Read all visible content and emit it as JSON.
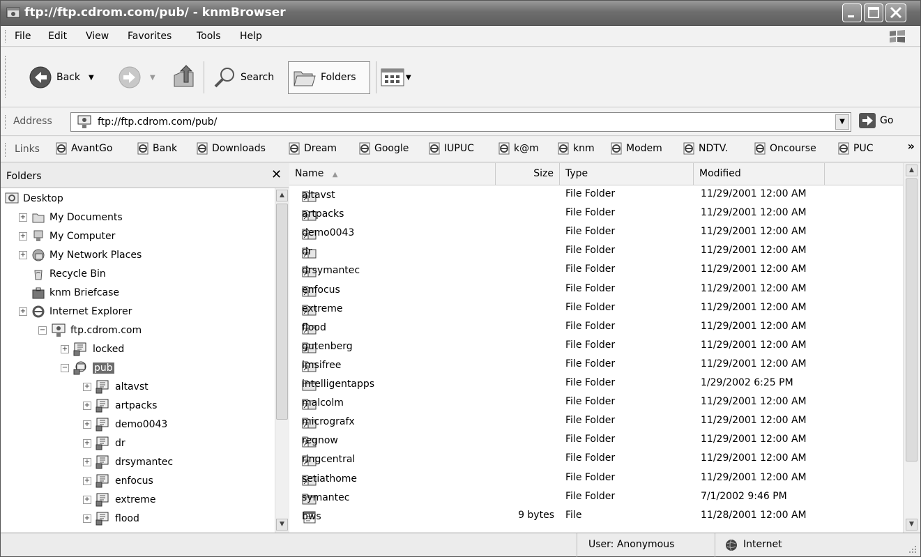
{
  "window": {
    "title": "ftp://ftp.cdrom.com/pub/ - knmBrowser"
  },
  "menu": [
    "File",
    "Edit",
    "View",
    "Favorites",
    "Tools",
    "Help"
  ],
  "toolbar": {
    "back": "Back",
    "search": "Search",
    "folders": "Folders"
  },
  "address": {
    "label": "Address",
    "value": "ftp://ftp.cdrom.com/pub/",
    "go": "Go"
  },
  "links": {
    "label": "Links",
    "items": [
      "AvantGo",
      "Bank",
      "Downloads",
      "Dream",
      "Google",
      "IUPUC",
      "k@m",
      "knm",
      "Modem",
      "NDTV.",
      "Oncourse",
      "PUC"
    ]
  },
  "folders_pane": {
    "title": "Folders",
    "tree": [
      {
        "label": "Desktop",
        "icon": "desktop-icon",
        "pm": "",
        "level": 0
      },
      {
        "label": "My Documents",
        "icon": "documents-folder-icon",
        "pm": "+",
        "level": 1
      },
      {
        "label": "My Computer",
        "icon": "computer-icon",
        "pm": "+",
        "level": 1
      },
      {
        "label": "My Network Places",
        "icon": "network-icon",
        "pm": "+",
        "level": 1
      },
      {
        "label": "Recycle Bin",
        "icon": "recycle-bin-icon",
        "pm": "",
        "level": 1
      },
      {
        "label": "knm Briefcase",
        "icon": "briefcase-icon",
        "pm": "",
        "level": 1
      },
      {
        "label": "Internet Explorer",
        "icon": "ie-icon",
        "pm": "+",
        "level": 1
      },
      {
        "label": "ftp.cdrom.com",
        "icon": "ftp-site-icon",
        "pm": "−",
        "level": 2
      },
      {
        "label": "locked",
        "icon": "ftp-folder-icon",
        "pm": "+",
        "level": 3
      },
      {
        "label": "pub",
        "icon": "ftp-folder-open-icon",
        "pm": "−",
        "level": 3,
        "selected": true
      },
      {
        "label": "altavst",
        "icon": "ftp-folder-icon",
        "pm": "+",
        "level": 4
      },
      {
        "label": "artpacks",
        "icon": "ftp-folder-icon",
        "pm": "+",
        "level": 4
      },
      {
        "label": "demo0043",
        "icon": "ftp-folder-icon",
        "pm": "+",
        "level": 4
      },
      {
        "label": "dr",
        "icon": "ftp-folder-icon",
        "pm": "+",
        "level": 4
      },
      {
        "label": "drsymantec",
        "icon": "ftp-folder-icon",
        "pm": "+",
        "level": 4
      },
      {
        "label": "enfocus",
        "icon": "ftp-folder-icon",
        "pm": "+",
        "level": 4
      },
      {
        "label": "extreme",
        "icon": "ftp-folder-icon",
        "pm": "+",
        "level": 4
      },
      {
        "label": "flood",
        "icon": "ftp-folder-icon",
        "pm": "+",
        "level": 4
      }
    ]
  },
  "file_list": {
    "columns": [
      "Name",
      "Size",
      "Type",
      "Modified"
    ],
    "rows": [
      {
        "name": "altavst",
        "size": "",
        "type": "File Folder",
        "modified": "11/29/2001 12:00 AM",
        "icon": "shortcut-folder-icon"
      },
      {
        "name": "artpacks",
        "size": "",
        "type": "File Folder",
        "modified": "11/29/2001 12:00 AM",
        "icon": "shortcut-folder-icon"
      },
      {
        "name": "demo0043",
        "size": "",
        "type": "File Folder",
        "modified": "11/29/2001 12:00 AM",
        "icon": "shortcut-folder-icon"
      },
      {
        "name": "dr",
        "size": "",
        "type": "File Folder",
        "modified": "11/29/2001 12:00 AM",
        "icon": "shortcut-folder-icon"
      },
      {
        "name": "drsymantec",
        "size": "",
        "type": "File Folder",
        "modified": "11/29/2001 12:00 AM",
        "icon": "shortcut-folder-icon"
      },
      {
        "name": "enfocus",
        "size": "",
        "type": "File Folder",
        "modified": "11/29/2001 12:00 AM",
        "icon": "shortcut-folder-icon"
      },
      {
        "name": "extreme",
        "size": "",
        "type": "File Folder",
        "modified": "11/29/2001 12:00 AM",
        "icon": "shortcut-folder-icon"
      },
      {
        "name": "flood",
        "size": "",
        "type": "File Folder",
        "modified": "11/29/2001 12:00 AM",
        "icon": "shortcut-folder-icon"
      },
      {
        "name": "gutenberg",
        "size": "",
        "type": "File Folder",
        "modified": "11/29/2001 12:00 AM",
        "icon": "shortcut-folder-icon"
      },
      {
        "name": "imsifree",
        "size": "",
        "type": "File Folder",
        "modified": "11/29/2001 12:00 AM",
        "icon": "shortcut-folder-icon"
      },
      {
        "name": "intelligentapps",
        "size": "",
        "type": "File Folder",
        "modified": "1/29/2002 6:25 PM",
        "icon": "folder-icon"
      },
      {
        "name": "malcolm",
        "size": "",
        "type": "File Folder",
        "modified": "11/29/2001 12:00 AM",
        "icon": "shortcut-folder-icon"
      },
      {
        "name": "micrografx",
        "size": "",
        "type": "File Folder",
        "modified": "11/29/2001 12:00 AM",
        "icon": "shortcut-folder-icon"
      },
      {
        "name": "regnow",
        "size": "",
        "type": "File Folder",
        "modified": "11/29/2001 12:00 AM",
        "icon": "shortcut-folder-icon"
      },
      {
        "name": "ringcentral",
        "size": "",
        "type": "File Folder",
        "modified": "11/29/2001 12:00 AM",
        "icon": "shortcut-folder-icon"
      },
      {
        "name": "setiathome",
        "size": "",
        "type": "File Folder",
        "modified": "11/29/2001 12:00 AM",
        "icon": "shortcut-folder-icon"
      },
      {
        "name": "symantec",
        "size": "",
        "type": "File Folder",
        "modified": "7/1/2002 9:46 PM",
        "icon": "folder-icon"
      },
      {
        "name": "bws",
        "size": "9 bytes",
        "type": "File",
        "modified": "11/28/2001 12:00 AM",
        "icon": "file-icon"
      }
    ]
  },
  "status": {
    "user": "User: Anonymous",
    "zone": "Internet"
  }
}
